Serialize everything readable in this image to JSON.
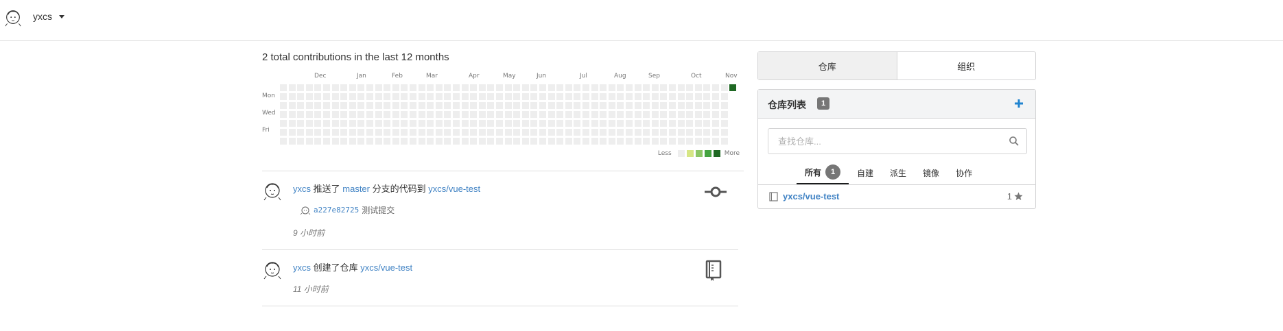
{
  "header": {
    "username": "yxcs"
  },
  "heatmap": {
    "title": "2 total contributions in the last 12 months",
    "months": [
      "Dec",
      "Jan",
      "Feb",
      "Mar",
      "Apr",
      "May",
      "Jun",
      "Jul",
      "Aug",
      "Sep",
      "Oct",
      "Nov"
    ],
    "days": [
      "Mon",
      "Wed",
      "Fri"
    ],
    "legend_less": "Less",
    "legend_more": "More",
    "legend_colors": [
      "#eeeeee",
      "#d6e685",
      "#8cc665",
      "#44a340",
      "#1e6823"
    ],
    "empty_color": "#eeeeee",
    "active_color": "#1e6823"
  },
  "feed": [
    {
      "user": "yxcs",
      "action": "推送了",
      "branch": "master",
      "middle": "分支的代码到",
      "repo": "yxcs/vue-test",
      "commit_sha": "a227e82725",
      "commit_msg": "测试提交",
      "time": "9 小时前",
      "icon": "git-commit-icon"
    },
    {
      "user": "yxcs",
      "action": "创建了仓库",
      "repo": "yxcs/vue-test",
      "time": "11 小时前",
      "icon": "repo-book-icon"
    }
  ],
  "sidebar": {
    "tabs": [
      "仓库",
      "组织"
    ],
    "repo_panel": {
      "title": "仓库列表",
      "count": "1",
      "search_placeholder": "查找仓库...",
      "filters": [
        {
          "label": "所有",
          "count": "1"
        },
        {
          "label": "自建"
        },
        {
          "label": "派生"
        },
        {
          "label": "镜像"
        },
        {
          "label": "协作"
        }
      ],
      "repos": [
        {
          "name": "yxcs/vue-test",
          "stars": "1"
        }
      ]
    }
  },
  "colors": {
    "link": "#4183c4",
    "plus": "#2185d0"
  }
}
